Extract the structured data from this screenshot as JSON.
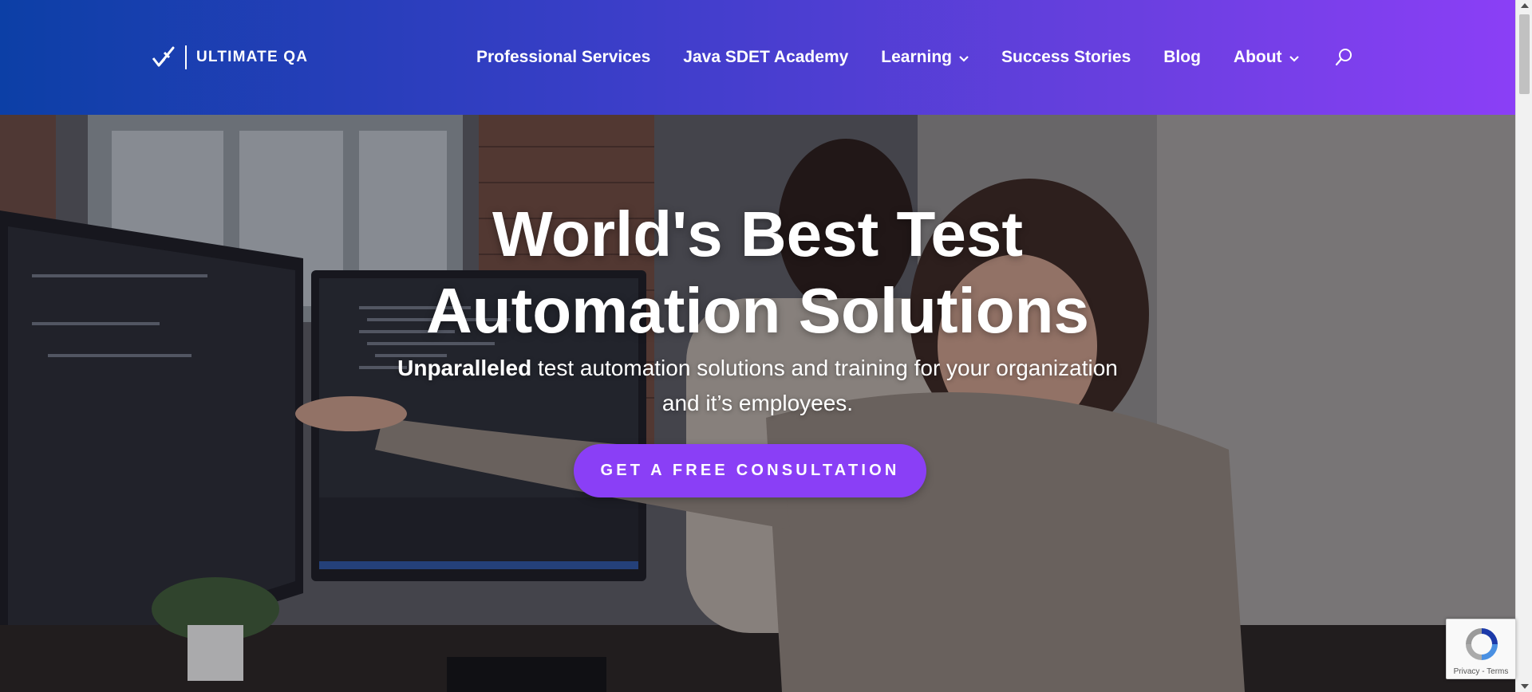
{
  "header": {
    "logo_text": "ULTIMATE QA",
    "nav": [
      {
        "label": "Professional Services",
        "dropdown": false
      },
      {
        "label": "Java SDET Academy",
        "dropdown": false
      },
      {
        "label": "Learning",
        "dropdown": true
      },
      {
        "label": "Success Stories",
        "dropdown": false
      },
      {
        "label": "Blog",
        "dropdown": false
      },
      {
        "label": "About",
        "dropdown": true
      }
    ],
    "search_icon": "search-icon"
  },
  "hero": {
    "title_line1": "World's Best Test",
    "title_line2": "Automation Solutions",
    "subtitle_bold": "Unparalleled",
    "subtitle_rest": " test automation solutions and training for your organization",
    "subtitle_line2": "and it’s employees.",
    "cta_label": "GET A FREE CONSULTATION"
  },
  "recaptcha": {
    "links": "Privacy - Terms"
  },
  "colors": {
    "header_start": "#0c3fa6",
    "header_end": "#8b3ff6",
    "cta": "#8a3ff6"
  }
}
